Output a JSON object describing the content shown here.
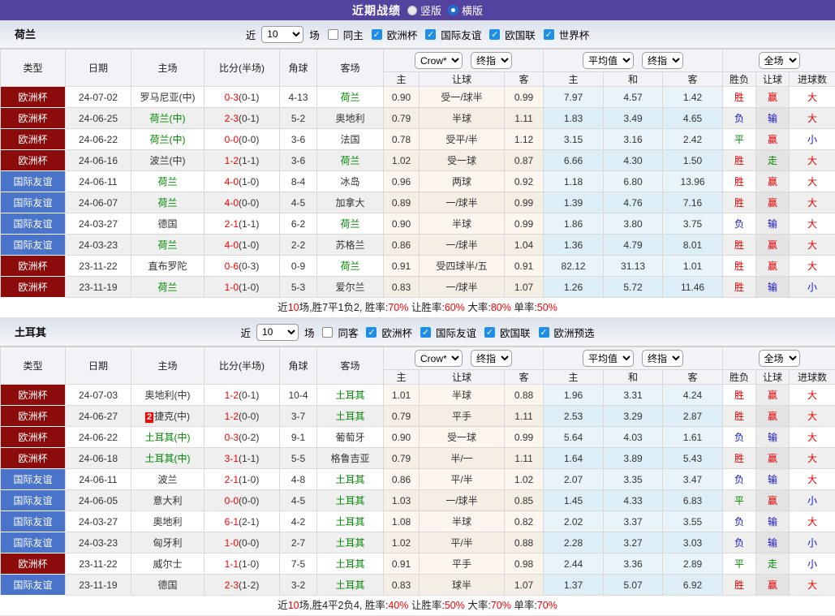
{
  "topbar": {
    "title": "近期战绩",
    "radio_vertical": "竖版",
    "radio_horizontal": "横版"
  },
  "table_header": {
    "col_type": "类型",
    "col_date": "日期",
    "col_home": "主场",
    "col_score": "比分(半场)",
    "col_corner": "角球",
    "col_away": "客场",
    "dd_crow": "Crow*",
    "dd_final1": "终指",
    "dd_avg": "平均值",
    "dd_final2": "终指",
    "dd_full": "全场",
    "sub_home": "主",
    "sub_handicap": "让球",
    "sub_away": "客",
    "sub_avg_home": "主",
    "sub_avg_draw": "和",
    "sub_avg_away": "客",
    "sub_wdl": "胜负",
    "sub_let": "让球",
    "sub_goals": "进球数"
  },
  "colors": {
    "topbar_purple": "#53429E",
    "euro_badge": "#8C0B0B",
    "friendly_badge": "#4A74C9",
    "team_green": "#008800",
    "score_red": "#ff0000",
    "result_red": "#e60000",
    "result_blue": "#1414cc",
    "result_green": "#008800",
    "crow_col_bg": "#fdf6ee",
    "avg_col_bg": "#e9f4fa"
  },
  "sections": [
    {
      "team": "荷兰",
      "filter": {
        "near_label": "近",
        "count": "10",
        "games_label": "场",
        "same_label": "同主",
        "leagues": [
          "欧洲杯",
          "国际友谊",
          "欧国联",
          "世界杯"
        ]
      },
      "rows": [
        {
          "league": "欧洲杯",
          "league_type": "euro",
          "date": "24-07-02",
          "home": "罗马尼亚(中)",
          "home_green": false,
          "home_badge": "",
          "score": "0-3",
          "half": "(0-1)",
          "corner": "4-13",
          "away": "荷兰",
          "away_green": true,
          "o1": "0.90",
          "handicap": "受一/球半",
          "o2": "0.99",
          "a1": "7.97",
          "a2": "4.57",
          "a3": "1.42",
          "r1": "胜",
          "r1c": "red",
          "r2": "赢",
          "r2c": "red",
          "r3": "大",
          "r3c": "red"
        },
        {
          "league": "欧洲杯",
          "league_type": "euro",
          "date": "24-06-25",
          "home": "荷兰(中)",
          "home_green": true,
          "home_badge": "",
          "score": "2-3",
          "half": "(0-1)",
          "corner": "5-2",
          "away": "奥地利",
          "away_green": false,
          "o1": "0.79",
          "handicap": "半球",
          "o2": "1.11",
          "a1": "1.83",
          "a2": "3.49",
          "a3": "4.65",
          "r1": "负",
          "r1c": "blue",
          "r2": "输",
          "r2c": "blue",
          "r3": "大",
          "r3c": "red"
        },
        {
          "league": "欧洲杯",
          "league_type": "euro",
          "date": "24-06-22",
          "home": "荷兰(中)",
          "home_green": true,
          "home_badge": "",
          "score": "0-0",
          "half": "(0-0)",
          "corner": "3-6",
          "away": "法国",
          "away_green": false,
          "o1": "0.78",
          "handicap": "受平/半",
          "o2": "1.12",
          "a1": "3.15",
          "a2": "3.16",
          "a3": "2.42",
          "r1": "平",
          "r1c": "green",
          "r2": "赢",
          "r2c": "red",
          "r3": "小",
          "r3c": "blue"
        },
        {
          "league": "欧洲杯",
          "league_type": "euro",
          "date": "24-06-16",
          "home": "波兰(中)",
          "home_green": false,
          "home_badge": "",
          "score": "1-2",
          "half": "(1-1)",
          "corner": "3-6",
          "away": "荷兰",
          "away_green": true,
          "o1": "1.02",
          "handicap": "受一球",
          "o2": "0.87",
          "a1": "6.66",
          "a2": "4.30",
          "a3": "1.50",
          "r1": "胜",
          "r1c": "red",
          "r2": "走",
          "r2c": "green",
          "r3": "大",
          "r3c": "red"
        },
        {
          "league": "国际友谊",
          "league_type": "friendly",
          "date": "24-06-11",
          "home": "荷兰",
          "home_green": true,
          "home_badge": "",
          "score": "4-0",
          "half": "(1-0)",
          "corner": "8-4",
          "away": "冰岛",
          "away_green": false,
          "o1": "0.96",
          "handicap": "两球",
          "o2": "0.92",
          "a1": "1.18",
          "a2": "6.80",
          "a3": "13.96",
          "r1": "胜",
          "r1c": "red",
          "r2": "赢",
          "r2c": "red",
          "r3": "大",
          "r3c": "red"
        },
        {
          "league": "国际友谊",
          "league_type": "friendly",
          "date": "24-06-07",
          "home": "荷兰",
          "home_green": true,
          "home_badge": "",
          "score": "4-0",
          "half": "(0-0)",
          "corner": "4-5",
          "away": "加拿大",
          "away_green": false,
          "o1": "0.89",
          "handicap": "一/球半",
          "o2": "0.99",
          "a1": "1.39",
          "a2": "4.76",
          "a3": "7.16",
          "r1": "胜",
          "r1c": "red",
          "r2": "赢",
          "r2c": "red",
          "r3": "大",
          "r3c": "red"
        },
        {
          "league": "国际友谊",
          "league_type": "friendly",
          "date": "24-03-27",
          "home": "德国",
          "home_green": false,
          "home_badge": "",
          "score": "2-1",
          "half": "(1-1)",
          "corner": "6-2",
          "away": "荷兰",
          "away_green": true,
          "o1": "0.90",
          "handicap": "半球",
          "o2": "0.99",
          "a1": "1.86",
          "a2": "3.80",
          "a3": "3.75",
          "r1": "负",
          "r1c": "blue",
          "r2": "输",
          "r2c": "blue",
          "r3": "大",
          "r3c": "red"
        },
        {
          "league": "国际友谊",
          "league_type": "friendly",
          "date": "24-03-23",
          "home": "荷兰",
          "home_green": true,
          "home_badge": "",
          "score": "4-0",
          "half": "(1-0)",
          "corner": "2-2",
          "away": "苏格兰",
          "away_green": false,
          "o1": "0.86",
          "handicap": "一/球半",
          "o2": "1.04",
          "a1": "1.36",
          "a2": "4.79",
          "a3": "8.01",
          "r1": "胜",
          "r1c": "red",
          "r2": "赢",
          "r2c": "red",
          "r3": "大",
          "r3c": "red"
        },
        {
          "league": "欧洲杯",
          "league_type": "euro",
          "date": "23-11-22",
          "home": "直布罗陀",
          "home_green": false,
          "home_badge": "",
          "score": "0-6",
          "half": "(0-3)",
          "corner": "0-9",
          "away": "荷兰",
          "away_green": true,
          "o1": "0.91",
          "handicap": "受四球半/五",
          "o2": "0.91",
          "a1": "82.12",
          "a2": "31.13",
          "a3": "1.01",
          "r1": "胜",
          "r1c": "red",
          "r2": "赢",
          "r2c": "red",
          "r3": "大",
          "r3c": "red"
        },
        {
          "league": "欧洲杯",
          "league_type": "euro",
          "date": "23-11-19",
          "home": "荷兰",
          "home_green": true,
          "home_badge": "",
          "score": "1-0",
          "half": "(1-0)",
          "corner": "5-3",
          "away": "爱尔兰",
          "away_green": false,
          "o1": "0.83",
          "handicap": "一/球半",
          "o2": "1.07",
          "a1": "1.26",
          "a2": "5.72",
          "a3": "11.46",
          "r1": "胜",
          "r1c": "red",
          "r2": "输",
          "r2c": "blue",
          "r3": "小",
          "r3c": "blue"
        }
      ],
      "summary": [
        {
          "text": "近",
          "red": false
        },
        {
          "text": "10",
          "red": true
        },
        {
          "text": "场,胜7平1负2, 胜率:",
          "red": false
        },
        {
          "text": "70%",
          "red": true
        },
        {
          "text": " 让胜率:",
          "red": false
        },
        {
          "text": "60%",
          "red": true
        },
        {
          "text": " 大率:",
          "red": false
        },
        {
          "text": "80%",
          "red": true
        },
        {
          "text": " 单率:",
          "red": false
        },
        {
          "text": "50%",
          "red": true
        }
      ]
    },
    {
      "team": "土耳其",
      "filter": {
        "near_label": "近",
        "count": "10",
        "games_label": "场",
        "same_label": "同客",
        "leagues": [
          "欧洲杯",
          "国际友谊",
          "欧国联",
          "欧洲预选"
        ]
      },
      "rows": [
        {
          "league": "欧洲杯",
          "league_type": "euro",
          "date": "24-07-03",
          "home": "奥地利(中)",
          "home_green": false,
          "home_badge": "",
          "score": "1-2",
          "half": "(0-1)",
          "corner": "10-4",
          "away": "土耳其",
          "away_green": true,
          "o1": "1.01",
          "handicap": "半球",
          "o2": "0.88",
          "a1": "1.96",
          "a2": "3.31",
          "a3": "4.24",
          "r1": "胜",
          "r1c": "red",
          "r2": "赢",
          "r2c": "red",
          "r3": "大",
          "r3c": "red"
        },
        {
          "league": "欧洲杯",
          "league_type": "euro",
          "date": "24-06-27",
          "home": "捷克(中)",
          "home_green": false,
          "home_badge": "2",
          "score": "1-2",
          "half": "(0-0)",
          "corner": "3-7",
          "away": "土耳其",
          "away_green": true,
          "o1": "0.79",
          "handicap": "平手",
          "o2": "1.11",
          "a1": "2.53",
          "a2": "3.29",
          "a3": "2.87",
          "r1": "胜",
          "r1c": "red",
          "r2": "赢",
          "r2c": "red",
          "r3": "大",
          "r3c": "red"
        },
        {
          "league": "欧洲杯",
          "league_type": "euro",
          "date": "24-06-22",
          "home": "土耳其(中)",
          "home_green": true,
          "home_badge": "",
          "score": "0-3",
          "half": "(0-2)",
          "corner": "9-1",
          "away": "葡萄牙",
          "away_green": false,
          "o1": "0.90",
          "handicap": "受一球",
          "o2": "0.99",
          "a1": "5.64",
          "a2": "4.03",
          "a3": "1.61",
          "r1": "负",
          "r1c": "blue",
          "r2": "输",
          "r2c": "blue",
          "r3": "大",
          "r3c": "red"
        },
        {
          "league": "欧洲杯",
          "league_type": "euro",
          "date": "24-06-18",
          "home": "土耳其(中)",
          "home_green": true,
          "home_badge": "",
          "score": "3-1",
          "half": "(1-1)",
          "corner": "5-5",
          "away": "格鲁吉亚",
          "away_green": false,
          "o1": "0.79",
          "handicap": "半/一",
          "o2": "1.11",
          "a1": "1.64",
          "a2": "3.89",
          "a3": "5.43",
          "r1": "胜",
          "r1c": "red",
          "r2": "赢",
          "r2c": "red",
          "r3": "大",
          "r3c": "red"
        },
        {
          "league": "国际友谊",
          "league_type": "friendly",
          "date": "24-06-11",
          "home": "波兰",
          "home_green": false,
          "home_badge": "",
          "score": "2-1",
          "half": "(1-0)",
          "corner": "4-8",
          "away": "土耳其",
          "away_green": true,
          "o1": "0.86",
          "handicap": "平/半",
          "o2": "1.02",
          "a1": "2.07",
          "a2": "3.35",
          "a3": "3.47",
          "r1": "负",
          "r1c": "blue",
          "r2": "输",
          "r2c": "blue",
          "r3": "大",
          "r3c": "red"
        },
        {
          "league": "国际友谊",
          "league_type": "friendly",
          "date": "24-06-05",
          "home": "意大利",
          "home_green": false,
          "home_badge": "",
          "score": "0-0",
          "half": "(0-0)",
          "corner": "4-5",
          "away": "土耳其",
          "away_green": true,
          "o1": "1.03",
          "handicap": "一/球半",
          "o2": "0.85",
          "a1": "1.45",
          "a2": "4.33",
          "a3": "6.83",
          "r1": "平",
          "r1c": "green",
          "r2": "赢",
          "r2c": "red",
          "r3": "小",
          "r3c": "blue"
        },
        {
          "league": "国际友谊",
          "league_type": "friendly",
          "date": "24-03-27",
          "home": "奥地利",
          "home_green": false,
          "home_badge": "",
          "score": "6-1",
          "half": "(2-1)",
          "corner": "4-2",
          "away": "土耳其",
          "away_green": true,
          "o1": "1.08",
          "handicap": "半球",
          "o2": "0.82",
          "a1": "2.02",
          "a2": "3.37",
          "a3": "3.55",
          "r1": "负",
          "r1c": "blue",
          "r2": "输",
          "r2c": "blue",
          "r3": "大",
          "r3c": "red"
        },
        {
          "league": "国际友谊",
          "league_type": "friendly",
          "date": "24-03-23",
          "home": "匈牙利",
          "home_green": false,
          "home_badge": "",
          "score": "1-0",
          "half": "(0-0)",
          "corner": "2-7",
          "away": "土耳其",
          "away_green": true,
          "o1": "1.02",
          "handicap": "平/半",
          "o2": "0.88",
          "a1": "2.28",
          "a2": "3.27",
          "a3": "3.03",
          "r1": "负",
          "r1c": "blue",
          "r2": "输",
          "r2c": "blue",
          "r3": "小",
          "r3c": "blue"
        },
        {
          "league": "欧洲杯",
          "league_type": "euro",
          "date": "23-11-22",
          "home": "威尔士",
          "home_green": false,
          "home_badge": "",
          "score": "1-1",
          "half": "(1-0)",
          "corner": "7-5",
          "away": "土耳其",
          "away_green": true,
          "o1": "0.91",
          "handicap": "平手",
          "o2": "0.98",
          "a1": "2.44",
          "a2": "3.36",
          "a3": "2.89",
          "r1": "平",
          "r1c": "green",
          "r2": "走",
          "r2c": "green",
          "r3": "小",
          "r3c": "blue"
        },
        {
          "league": "国际友谊",
          "league_type": "friendly",
          "date": "23-11-19",
          "home": "德国",
          "home_green": false,
          "home_badge": "",
          "score": "2-3",
          "half": "(1-2)",
          "corner": "3-2",
          "away": "土耳其",
          "away_green": true,
          "o1": "0.83",
          "handicap": "球半",
          "o2": "1.07",
          "a1": "1.37",
          "a2": "5.07",
          "a3": "6.92",
          "r1": "胜",
          "r1c": "red",
          "r2": "赢",
          "r2c": "red",
          "r3": "大",
          "r3c": "red"
        }
      ],
      "summary": [
        {
          "text": "近",
          "red": false
        },
        {
          "text": "10",
          "red": true
        },
        {
          "text": "场,胜4平2负4, 胜率:",
          "red": false
        },
        {
          "text": "40%",
          "red": true
        },
        {
          "text": " 让胜率:",
          "red": false
        },
        {
          "text": "50%",
          "red": true
        },
        {
          "text": " 大率:",
          "red": false
        },
        {
          "text": "70%",
          "red": true
        },
        {
          "text": " 单率:",
          "red": false
        },
        {
          "text": "70%",
          "red": true
        }
      ]
    }
  ]
}
